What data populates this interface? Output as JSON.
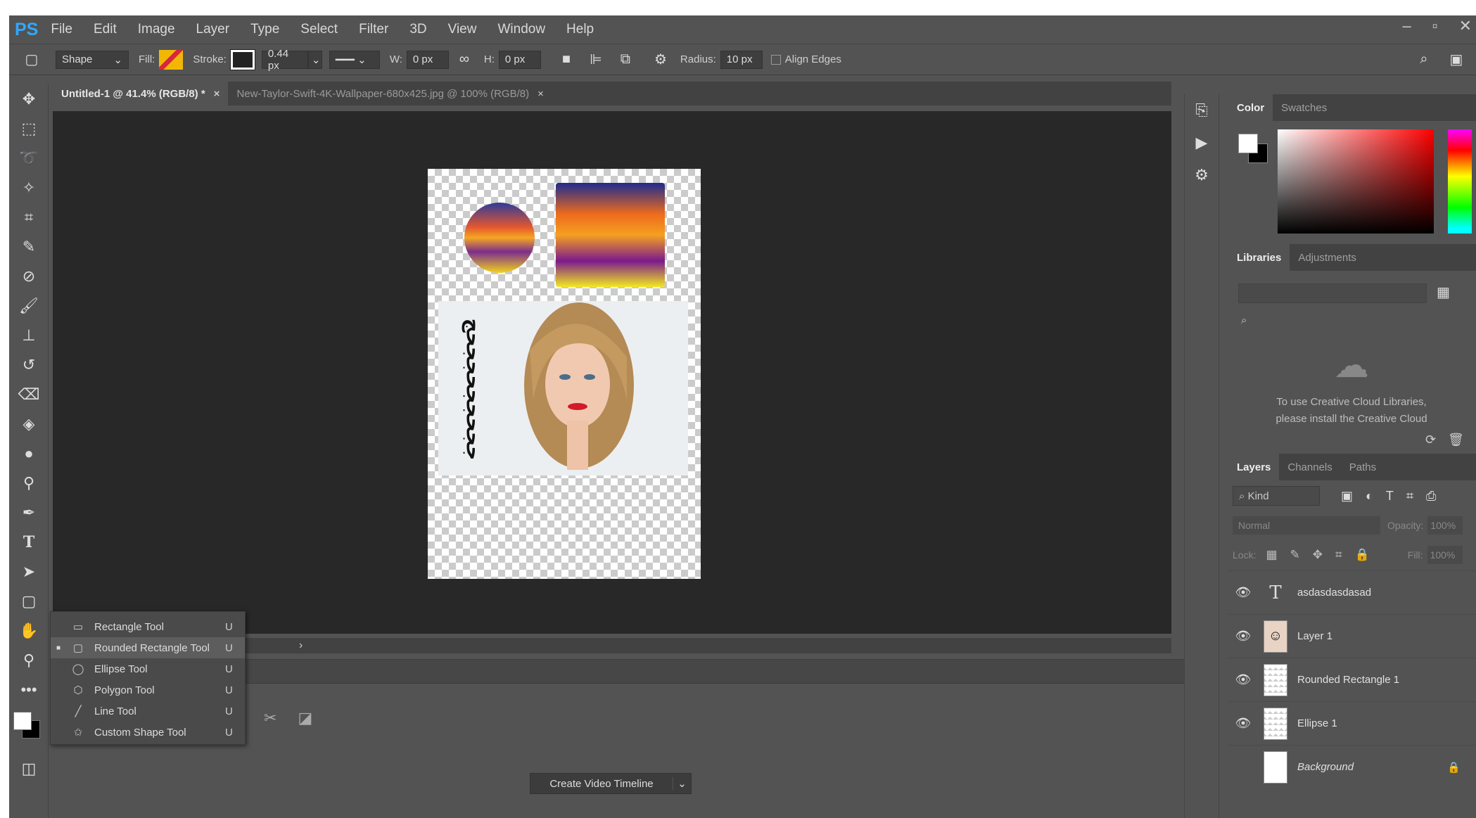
{
  "app": {
    "logo": "PS"
  },
  "menu": [
    "File",
    "Edit",
    "Image",
    "Layer",
    "Type",
    "Select",
    "Filter",
    "3D",
    "View",
    "Window",
    "Help"
  ],
  "options": {
    "mode": "Shape",
    "fill_label": "Fill:",
    "stroke_label": "Stroke:",
    "stroke_width": "0.44 px",
    "w_label": "W:",
    "w_value": "0 px",
    "h_label": "H:",
    "h_value": "0 px",
    "radius_label": "Radius:",
    "radius_value": "10 px",
    "align_edges": "Align Edges"
  },
  "tabs": [
    {
      "label": "Untitled-1 @ 41.4% (RGB/8) *",
      "close": "×"
    },
    {
      "label": "New-Taylor-Swift-4K-Wallpaper-680x425.jpg @ 100% (RGB/8)",
      "close": "×"
    }
  ],
  "canvas": {
    "vertical_text": "ججحججحججحج"
  },
  "flyout": [
    {
      "label": "Rectangle Tool",
      "key": "U",
      "icon": "rectangle-icon"
    },
    {
      "label": "Rounded Rectangle Tool",
      "key": "U",
      "icon": "rounded-rectangle-icon"
    },
    {
      "label": "Ellipse Tool",
      "key": "U",
      "icon": "ellipse-icon"
    },
    {
      "label": "Polygon Tool",
      "key": "U",
      "icon": "polygon-icon"
    },
    {
      "label": "Line Tool",
      "key": "U",
      "icon": "line-icon"
    },
    {
      "label": "Custom Shape Tool",
      "key": "U",
      "icon": "custom-shape-icon"
    }
  ],
  "timeline": {
    "button": "Create Video Timeline"
  },
  "color_panel": {
    "tabs": [
      "Color",
      "Swatches"
    ]
  },
  "libraries_panel": {
    "tabs": [
      "Libraries",
      "Adjustments"
    ],
    "message_line1": "To use Creative Cloud Libraries,",
    "message_line2": "please install the Creative Cloud"
  },
  "layers_panel": {
    "tabs": [
      "Layers",
      "Channels",
      "Paths"
    ],
    "kind": "Kind",
    "blend": "Normal",
    "opacity_label": "Opacity:",
    "opacity": "100%",
    "lock_label": "Lock:",
    "fill_label": "Fill:",
    "fill": "100%",
    "layers": [
      {
        "name": "asdasdasdasad",
        "kind": "text"
      },
      {
        "name": "Layer 1",
        "kind": "image"
      },
      {
        "name": "Rounded Rectangle 1",
        "kind": "shape"
      },
      {
        "name": "Ellipse 1",
        "kind": "shape"
      },
      {
        "name": "Background",
        "kind": "background"
      }
    ]
  },
  "colors": {
    "ps_blue": "#31a8ff",
    "ui_gray": "#535353",
    "canvas_bg": "#282828"
  }
}
